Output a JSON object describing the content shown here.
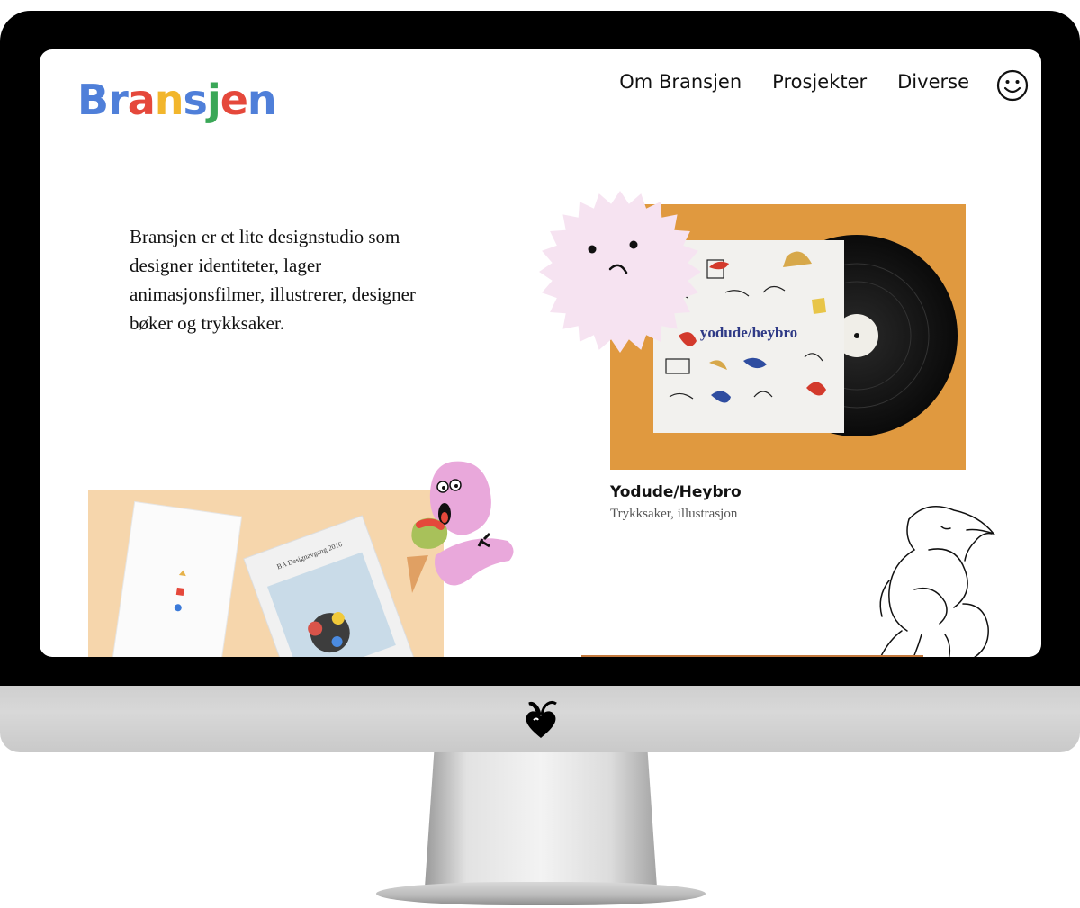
{
  "logo": {
    "letters": [
      {
        "ch": "B",
        "color": "#4f7fd9"
      },
      {
        "ch": "r",
        "color": "#4f7fd9"
      },
      {
        "ch": "a",
        "color": "#e5483b"
      },
      {
        "ch": "n",
        "color": "#f2b62c"
      },
      {
        "ch": "s",
        "color": "#4f7fd9"
      },
      {
        "ch": "j",
        "color": "#3aa757"
      },
      {
        "ch": "e",
        "color": "#e5483b"
      },
      {
        "ch": "n",
        "color": "#4f7fd9"
      }
    ]
  },
  "nav": {
    "items": [
      {
        "label": "Om Bransjen"
      },
      {
        "label": "Prosjekter"
      },
      {
        "label": "Diverse"
      }
    ]
  },
  "intro": {
    "text": "Bransjen er et lite designstudio som designer identiteter, lager animasjonsfilmer, illustrerer, designer bøker og trykksaker."
  },
  "project": {
    "title": "Yodude/Heybro",
    "tags": "Trykksaker, illustrasjon",
    "cover_text": "yodude/heybro",
    "bg_color": "#e0993f"
  },
  "second_project": {
    "booklet_title": "BA Designavgang 2016"
  }
}
